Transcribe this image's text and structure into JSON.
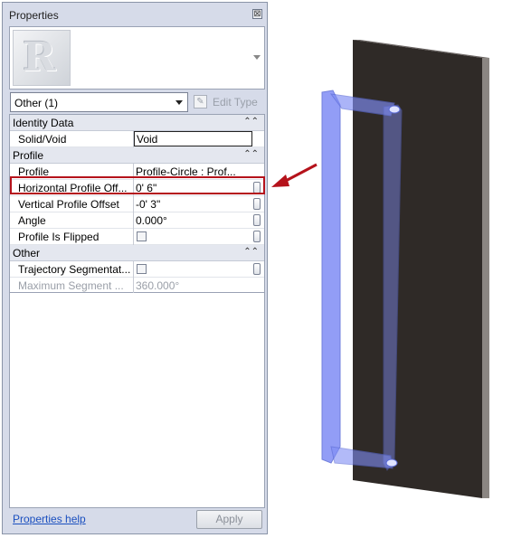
{
  "palette": {
    "title": "Properties",
    "close_glyph": "⊠",
    "logo_text": "R",
    "type_selector": {
      "value": "Other (1)"
    },
    "edit_type_label": "Edit Type",
    "rows": [
      {
        "kind": "group",
        "name": "Identity Data",
        "collapse": "⌃⌃"
      },
      {
        "kind": "prop",
        "name": "Solid/Void",
        "value": "Void",
        "editing": true
      },
      {
        "kind": "group",
        "name": "Profile",
        "collapse": "⌃⌃"
      },
      {
        "kind": "prop",
        "name": "Profile",
        "value": "Profile-Circle : Prof..."
      },
      {
        "kind": "prop",
        "name": "Horizontal Profile Off...",
        "value": "0'  6\"",
        "scroll": true,
        "highlighted": true
      },
      {
        "kind": "prop",
        "name": "Vertical Profile Offset",
        "value": "-0'  3\"",
        "scroll": true
      },
      {
        "kind": "prop",
        "name": "Angle",
        "value": "0.000°",
        "scroll": true
      },
      {
        "kind": "prop",
        "name": "Profile Is Flipped",
        "checkbox": true,
        "scroll": true
      },
      {
        "kind": "group",
        "name": "Other",
        "collapse": "⌃⌃"
      },
      {
        "kind": "prop",
        "name": "Trajectory Segmentat...",
        "checkbox": true,
        "scroll": true
      },
      {
        "kind": "prop",
        "name": "Maximum Segment ...",
        "value": "360.000°",
        "disabled": true
      }
    ],
    "help_link": "Properties help",
    "apply_label": "Apply"
  },
  "colors": {
    "highlight_border": "#b5121b",
    "annotation_arrow": "#b5121b",
    "panel_face": "#2f2a27",
    "void_blue": "#7f8df5"
  },
  "icons": {
    "close": "close-icon",
    "edit_type": "edit-type-icon",
    "dropdown": "chevron-down-icon"
  }
}
